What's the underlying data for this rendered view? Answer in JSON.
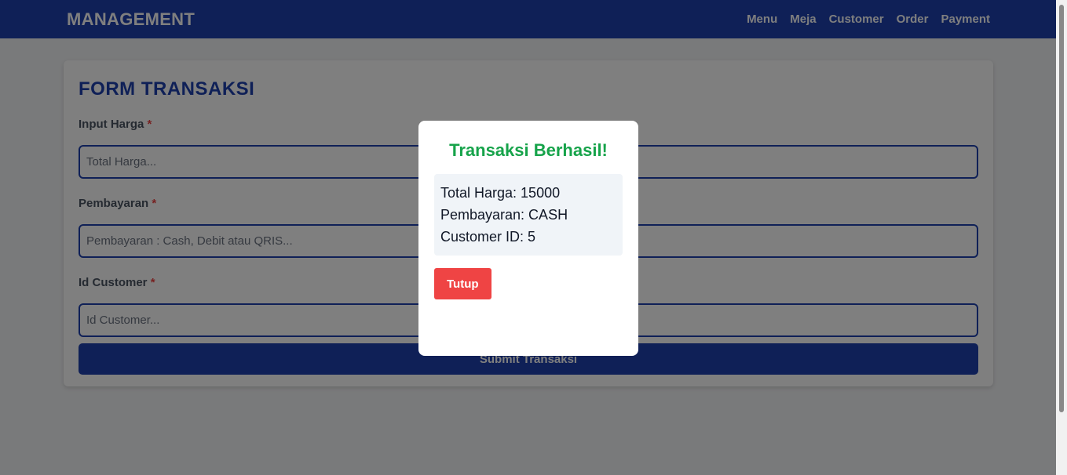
{
  "navbar": {
    "brand": "MANAGEMENT",
    "links": [
      "Menu",
      "Meja",
      "Customer",
      "Order",
      "Payment"
    ]
  },
  "form": {
    "title": "FORM TRANSAKSI",
    "required_marker": "*",
    "fields": [
      {
        "label": "Input Harga",
        "placeholder": "Total Harga...",
        "value": ""
      },
      {
        "label": "Pembayaran",
        "placeholder": "Pembayaran : Cash, Debit atau QRIS...",
        "value": ""
      },
      {
        "label": "Id Customer",
        "placeholder": "Id Customer...",
        "value": ""
      }
    ],
    "submit_label": "Submit Transaksi"
  },
  "modal": {
    "title": "Transaksi Berhasil!",
    "total_harga": "Total Harga: 15000",
    "pembayaran": "Pembayaran: CASH",
    "customer_id": "Customer ID: 5",
    "close_label": "Tutup"
  },
  "colors": {
    "primary": "#1e40af",
    "success": "#16a34a",
    "danger": "#ef4444",
    "overlay": "rgba(0,0,0,0.5)"
  }
}
